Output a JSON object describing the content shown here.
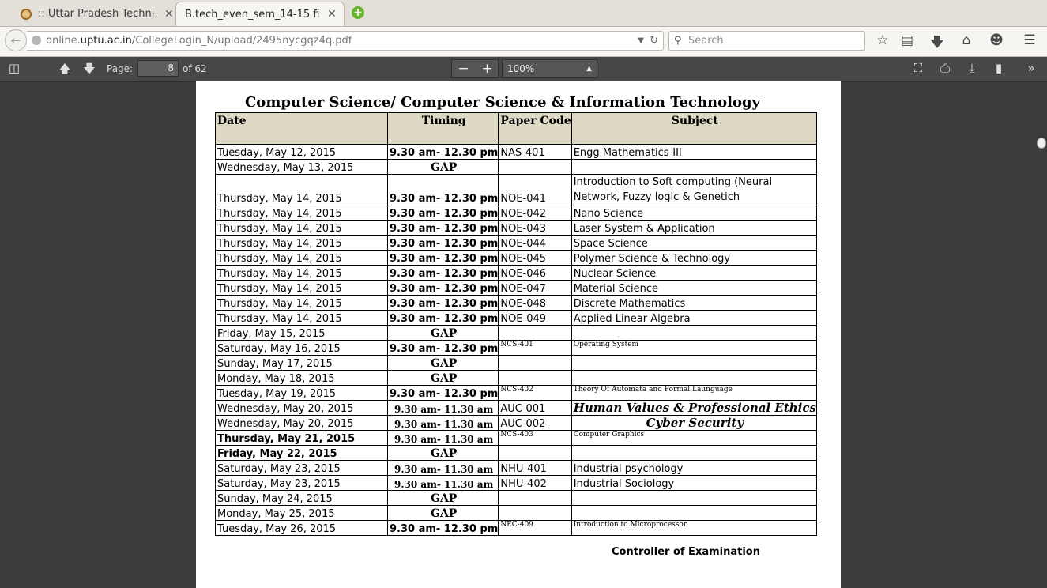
{
  "browser": {
    "tabs": [
      {
        "title": ":: Uttar Pradesh Techni…",
        "close": "✕"
      },
      {
        "title": "B.tech_even_sem_14-15 fi…",
        "close": "✕"
      }
    ],
    "new_tab": "+",
    "url_prefix": "online.",
    "url_domain": "uptu.ac.in",
    "url_path": "/CollegeLogin_N/upload/2495nycgqz4q.pdf",
    "search_placeholder": "Search"
  },
  "pdf_toolbar": {
    "page_label": "Page:",
    "page_value": "8",
    "page_total": "of 62",
    "zoom": "100%"
  },
  "document": {
    "title": "Computer Science/ Computer Science & Information Technology",
    "headers": {
      "date": "Date",
      "timing": "Timing",
      "paper_code": "Paper Code",
      "subject": "Subject"
    },
    "rows": [
      {
        "date": "Tuesday, May 12, 2015",
        "timing": "9.30 am- 12.30 pm",
        "code": "NAS-401",
        "subject": "Engg Mathematics-III"
      },
      {
        "date": "Wednesday, May 13, 2015",
        "gap": "GAP"
      },
      {
        "date": "Thursday, May 14, 2015",
        "timing": "9.30 am- 12.30 pm",
        "code": "NOE-041",
        "subject": "Introduction to Soft computing (Neural Network, Fuzzy logic & Genetich"
      },
      {
        "date": "Thursday, May 14, 2015",
        "timing": "9.30 am- 12.30 pm",
        "code": "NOE-042",
        "subject": "Nano Science"
      },
      {
        "date": "Thursday, May 14, 2015",
        "timing": "9.30 am- 12.30 pm",
        "code": "NOE-043",
        "subject": "Laser System & Application"
      },
      {
        "date": "Thursday, May 14, 2015",
        "timing": "9.30 am- 12.30 pm",
        "code": "NOE-044",
        "subject": "Space Science"
      },
      {
        "date": "Thursday, May 14, 2015",
        "timing": "9.30 am- 12.30 pm",
        "code": "NOE-045",
        "subject": "Polymer Science & Technology"
      },
      {
        "date": "Thursday, May 14, 2015",
        "timing": "9.30 am- 12.30 pm",
        "code": "NOE-046",
        "subject": "Nuclear Science"
      },
      {
        "date": "Thursday, May 14, 2015",
        "timing": "9.30 am- 12.30 pm",
        "code": "NOE-047",
        "subject": "Material Science"
      },
      {
        "date": "Thursday, May 14, 2015",
        "timing": "9.30 am- 12.30 pm",
        "code": "NOE-048",
        "subject": "Discrete Mathematics"
      },
      {
        "date": "Thursday, May 14, 2015",
        "timing": "9.30 am- 12.30 pm",
        "code": "NOE-049",
        "subject": "Applied Linear Algebra"
      },
      {
        "date": "Friday, May 15, 2015",
        "gap": "GAP"
      },
      {
        "date": "Saturday, May 16, 2015",
        "timing": "9.30 am- 12.30 pm",
        "code": "NCS-401",
        "subject": "Operating System"
      },
      {
        "date": "Sunday, May 17, 2015",
        "gap": "GAP"
      },
      {
        "date": "Monday, May 18, 2015",
        "gap": "GAP"
      },
      {
        "date": "Tuesday, May 19, 2015",
        "timing": "9.30 am- 12.30 pm",
        "code": "NCS-402",
        "subject": "Theory Of Automata and Formal Launguage"
      },
      {
        "date": "Wednesday, May 20, 2015",
        "timing": "9.30 am- 11.30 am",
        "code": "AUC-001",
        "subject": "Human Values & Professional Ethics"
      },
      {
        "date": "Wednesday, May 20, 2015",
        "timing": "9.30 am- 11.30 am",
        "code": "AUC-002",
        "subject": "Cyber  Security"
      },
      {
        "date": "Thursday, May 21, 2015",
        "timing": "9.30 am- 11.30 am",
        "code": "NCS-403",
        "subject": "Computer Graphics"
      },
      {
        "date": "Friday, May 22, 2015",
        "gap": "GAP"
      },
      {
        "date": "Saturday, May 23, 2015",
        "timing": "9.30 am- 11.30 am",
        "code": "NHU-401",
        "subject": "Industrial psychology"
      },
      {
        "date": "Saturday, May 23, 2015",
        "timing": "9.30 am- 11.30 am",
        "code": "NHU-402",
        "subject": "Industrial Sociology"
      },
      {
        "date": "Sunday, May 24, 2015",
        "gap": "GAP"
      },
      {
        "date": "Monday, May 25, 2015",
        "gap": "GAP"
      },
      {
        "date": "Tuesday, May 26, 2015",
        "timing": "9.30 am- 12.30 pm",
        "code": "NEC-409",
        "subject": "Introduction to Microprocessor"
      }
    ],
    "footer": "Controller of Examination"
  }
}
